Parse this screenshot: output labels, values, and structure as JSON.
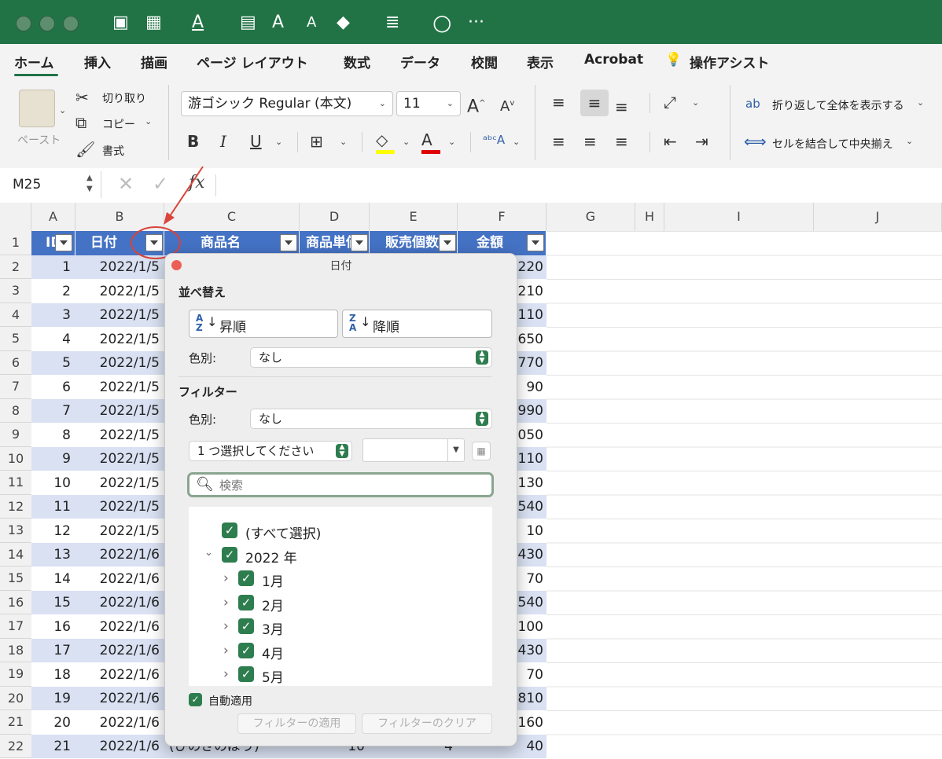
{
  "ribbon_tabs": [
    "ホーム",
    "挿入",
    "描画",
    "ページ レイアウト",
    "数式",
    "データ",
    "校閲",
    "表示",
    "Acrobat"
  ],
  "tell_me": "操作アシスト",
  "clipboard": {
    "paste": "ペースト",
    "cut": "切り取り",
    "copy": "コピー",
    "format_painter": "書式"
  },
  "font": {
    "name": "游ゴシック Regular (本文)",
    "size": "11"
  },
  "wrap_text": "折り返して全体を表示する",
  "merge_center": "セルを結合して中央揃え",
  "name_box": "M25",
  "fx": "fx",
  "columns": [
    "A",
    "B",
    "C",
    "D",
    "E",
    "F",
    "G",
    "H",
    "I",
    "J"
  ],
  "rows": [
    "1",
    "2",
    "3",
    "4",
    "5",
    "6",
    "7",
    "8",
    "9",
    "10",
    "11",
    "12",
    "13",
    "14",
    "15",
    "16",
    "17",
    "18",
    "19",
    "20",
    "21",
    "22"
  ],
  "table_headers": {
    "a": "ID",
    "b": "日付",
    "c": "商品名",
    "d": "商品単価",
    "e": "販売個数",
    "f": "金額"
  },
  "ids": [
    "1",
    "2",
    "3",
    "4",
    "5",
    "6",
    "7",
    "8",
    "9",
    "10",
    "11",
    "12",
    "13",
    "14",
    "15",
    "16",
    "17",
    "18",
    "19",
    "20",
    "21"
  ],
  "dates": [
    "2022/1/5",
    "2022/1/5",
    "2022/1/5",
    "2022/1/5",
    "2022/1/5",
    "2022/1/5",
    "2022/1/5",
    "2022/1/5",
    "2022/1/5",
    "2022/1/5",
    "2022/1/5",
    "2022/1/5",
    "2022/1/6",
    "2022/1/6",
    "2022/1/6",
    "2022/1/6",
    "2022/1/6",
    "2022/1/6",
    "2022/1/6",
    "2022/1/6",
    "2022/1/6"
  ],
  "amounts": [
    "220",
    ",210",
    "110",
    ",650",
    "770",
    "90",
    "990",
    ",050",
    "110",
    "130",
    "540",
    "10",
    ",430",
    "70",
    "540",
    "100",
    ",430",
    "70",
    "810",
    "160",
    "40"
  ],
  "row22": {
    "product": "(ひのきのぼう)",
    "price": "10",
    "qty": "4"
  },
  "popup": {
    "title": "日付",
    "sort_label": "並べ替え",
    "asc": "昇順",
    "desc": "降順",
    "color_label": "色別:",
    "sort_color_value": "なし",
    "filter_label": "フィルター",
    "filter_color_value": "なし",
    "condition": "1 つ選択してください",
    "search_placeholder": "検索",
    "tree": [
      "(すべて選択)",
      "2022 年",
      "1月",
      "2月",
      "3月",
      "4月",
      "5月"
    ],
    "auto_apply": "自動適用",
    "apply_btn": "フィルターの適用",
    "clear_btn": "フィルターのクリア"
  },
  "colors": {
    "excel_green": "#217346",
    "table_header": "#4472c4",
    "band": "#d9e1f2",
    "annotation": "#d9453a"
  }
}
